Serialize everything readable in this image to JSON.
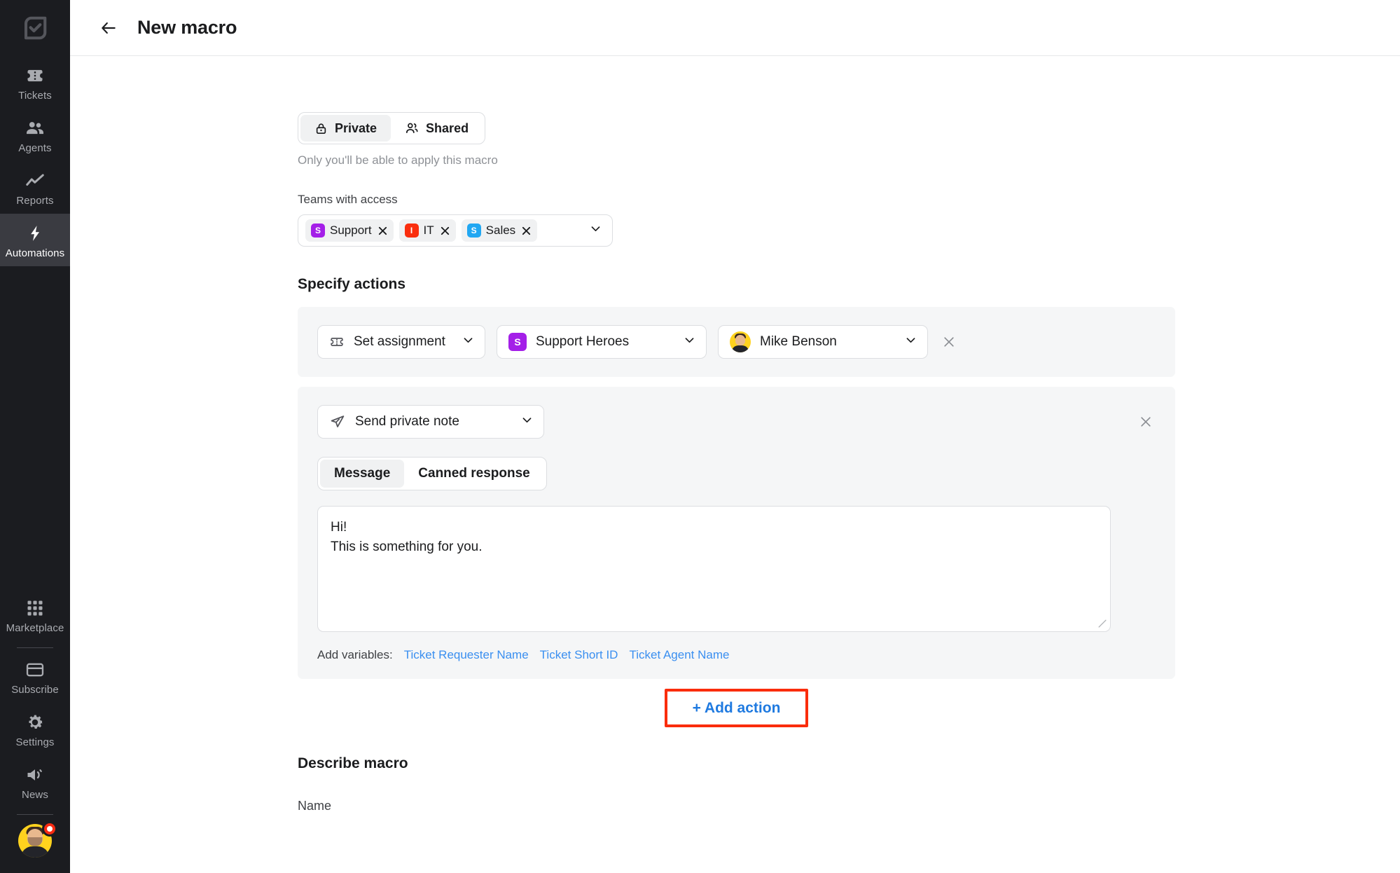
{
  "sidebar": {
    "logo": "checkbox-logo",
    "items": [
      {
        "label": "Tickets",
        "icon": "ticket-icon",
        "active": false
      },
      {
        "label": "Agents",
        "icon": "agents-icon",
        "active": false
      },
      {
        "label": "Reports",
        "icon": "reports-chart-icon",
        "active": false
      },
      {
        "label": "Automations",
        "icon": "lightning-bolt-icon",
        "active": true
      }
    ],
    "bottom_items": [
      {
        "label": "Marketplace",
        "icon": "grid-apps-icon"
      },
      {
        "label": "Subscribe",
        "icon": "credit-card-icon"
      },
      {
        "label": "Settings",
        "icon": "gear-icon"
      },
      {
        "label": "News",
        "icon": "megaphone-icon"
      }
    ],
    "avatar": {
      "name": "user-avatar",
      "has_notification": true
    }
  },
  "header": {
    "back_icon": "arrow-left-icon",
    "title": "New macro"
  },
  "visibility": {
    "options": [
      {
        "label": "Private",
        "icon": "lock-icon",
        "selected": true
      },
      {
        "label": "Shared",
        "icon": "people-icon",
        "selected": false
      }
    ],
    "hint": "Only you'll be able to apply this macro"
  },
  "teams": {
    "label": "Teams with access",
    "tags": [
      {
        "label": "Support",
        "initial": "S",
        "color": "#a41fe8"
      },
      {
        "label": "IT",
        "initial": "I",
        "color": "#fa2e0e"
      },
      {
        "label": "Sales",
        "initial": "S",
        "color": "#21a7f2"
      }
    ],
    "dropdown_icon": "chevron-down-icon"
  },
  "actions_section": {
    "title": "Specify actions",
    "action_1": {
      "type_select": {
        "value": "Set assignment",
        "icon": "ticket-icon"
      },
      "team_select": {
        "value": "Support Heroes",
        "initial": "S",
        "color": "#a41fe8"
      },
      "agent_select": {
        "value": "Mike Benson",
        "avatar": "agent-avatar"
      },
      "remove_icon": "close-icon"
    },
    "action_2": {
      "type_select": {
        "value": "Send private note",
        "icon": "send-paper-plane-icon"
      },
      "mode_toggle": [
        {
          "label": "Message",
          "selected": true
        },
        {
          "label": "Canned response",
          "selected": false
        }
      ],
      "note_text": "Hi!\nThis is something for you.",
      "note_placeholder": "",
      "variables_label": "Add variables:",
      "variables": [
        "Ticket Requester Name",
        "Ticket Short ID",
        "Ticket Agent Name"
      ],
      "remove_icon": "close-icon"
    },
    "add_action_label": "+ Add action",
    "add_action_highlight_color": "#fa2d0c"
  },
  "describe": {
    "title": "Describe macro",
    "name_label": "Name"
  }
}
